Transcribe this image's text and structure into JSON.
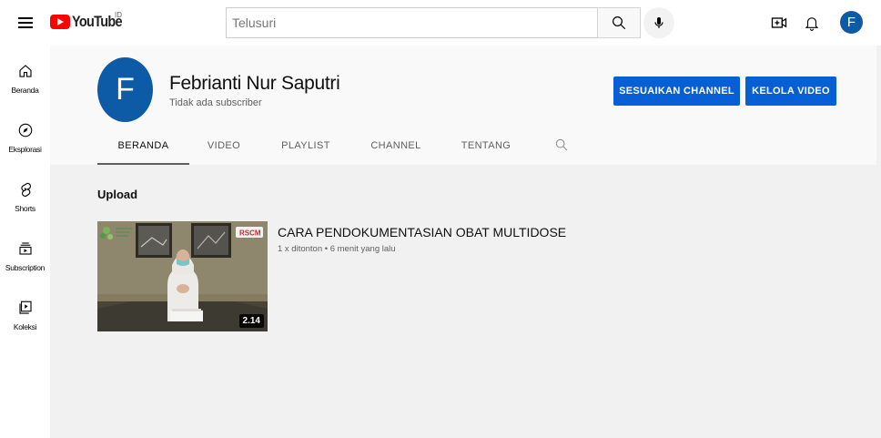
{
  "header": {
    "logo_text": "YouTube",
    "region": "ID",
    "search_placeholder": "Telusuri",
    "account_initial": "F"
  },
  "sidebar": {
    "items": [
      {
        "label": "Beranda",
        "icon": "home-icon"
      },
      {
        "label": "Eksplorasi",
        "icon": "compass-icon"
      },
      {
        "label": "Shorts",
        "icon": "shorts-icon"
      },
      {
        "label": "Subscription",
        "icon": "subscriptions-icon"
      },
      {
        "label": "Koleksi",
        "icon": "library-icon"
      }
    ]
  },
  "channel": {
    "avatar_initial": "F",
    "name": "Febrianti Nur Saputri",
    "subscribers": "Tidak ada subscriber",
    "customize_label": "SESUAIKAN CHANNEL",
    "manage_label": "KELOLA VIDEO",
    "tabs": [
      {
        "label": "BERANDA",
        "active": true
      },
      {
        "label": "VIDEO",
        "active": false
      },
      {
        "label": "PLAYLIST",
        "active": false
      },
      {
        "label": "CHANNEL",
        "active": false
      },
      {
        "label": "TENTANG",
        "active": false
      }
    ]
  },
  "uploads": {
    "section_title": "Upload",
    "videos": [
      {
        "title": "CARA PENDOKUMENTASIAN OBAT MULTIDOSE",
        "meta": "1 x ditonton • 6 menit yang lalu",
        "duration": "2.14",
        "thumb_badge": "RSCM"
      }
    ]
  },
  "colors": {
    "accent": "#065fd4",
    "avatar": "#0d5aa7",
    "logo_red": "#ff0000"
  }
}
